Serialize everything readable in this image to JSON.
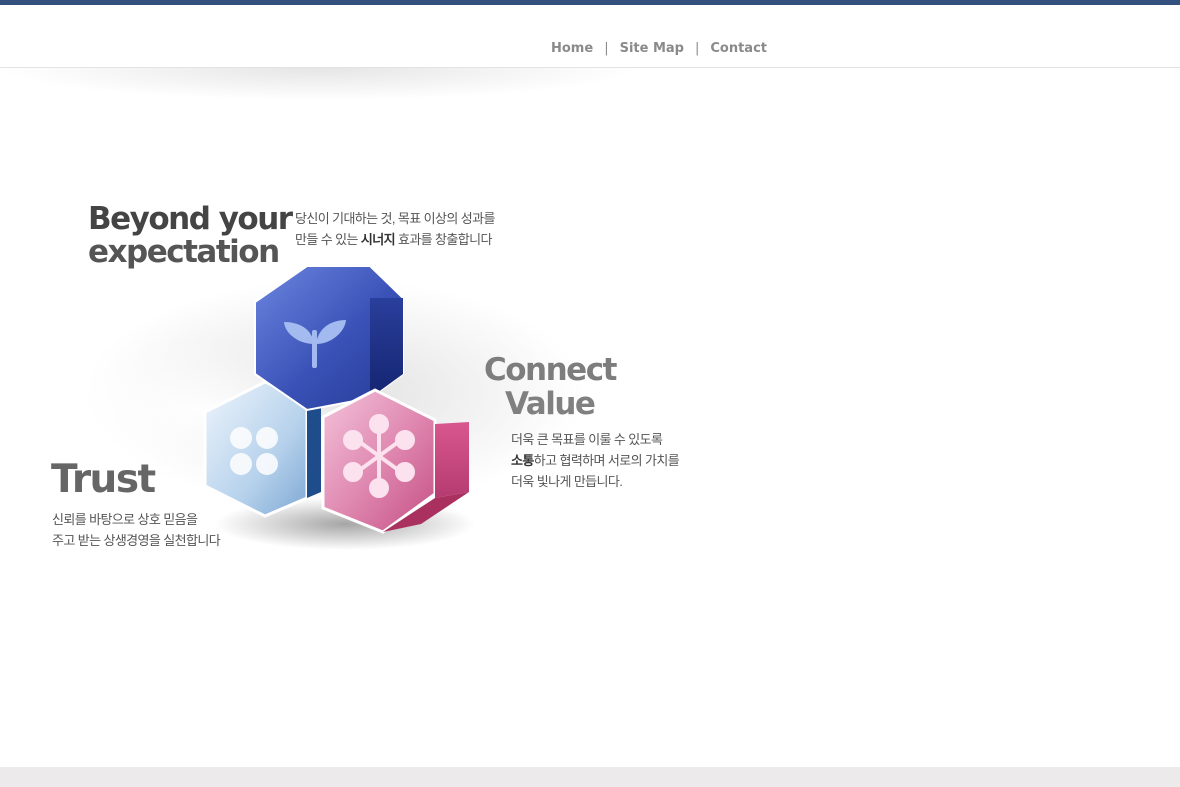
{
  "nav": {
    "home": "Home",
    "sep1": "|",
    "sitemap": "Site Map",
    "sep2": "|",
    "contact": "Contact"
  },
  "beyond": {
    "line1": "Beyond your",
    "line2": "expectation",
    "desc1": "당신이 기대하는 것, 목표 이상의 성과를",
    "desc2_pre": "만들 수 있는",
    "desc2_bold": "시너지",
    "desc2_post": "효과를 창출합니다"
  },
  "connect": {
    "line1": "Connect",
    "line2": "Value",
    "desc1": "더욱 큰 목표를 이룰 수 있도록",
    "desc2_bold": "소통",
    "desc2_post": "하고 협력하며 서로의 가치를",
    "desc3": "더욱 빛나게 만듭니다."
  },
  "trust": {
    "title": "Trust",
    "desc1": "신뢰를 바탕으로 상호 믿음을",
    "desc2": "주고 받는 상생경영을 실천합니다"
  },
  "icons": [
    "sprout-icon",
    "dots-icon",
    "network-icon"
  ],
  "colors": {
    "topbar": "#34507f",
    "blue": "#3b52b8",
    "pink": "#d65f92",
    "lightblue": "#a9c8e6",
    "footer": "#eceaea"
  }
}
